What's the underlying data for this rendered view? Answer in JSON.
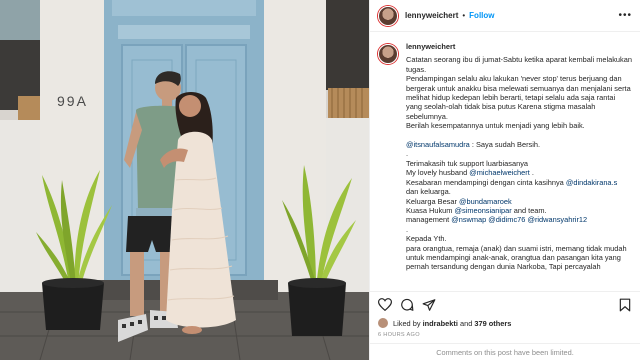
{
  "photo": {
    "house_number": "99A"
  },
  "header": {
    "username": "lennyweichert",
    "separator": "•",
    "follow_label": "Follow",
    "more_icon": "more-icon"
  },
  "caption": {
    "username": "lennyweichert",
    "lines": {
      "l1": "Catatan seorang ibu di jumat-Sabtu ketika aparat kembali melakukan tugas.",
      "l2": "Pendampingan selalu aku lakukan 'never stop' terus berjuang dan bergerak untuk anakku bisa melewati semuanya dan menjalani serta melihat hidup kedepan lebih berarti, tetapi selalu ada saja rantai yang seolah-olah tidak bisa putus Karena stigma masalah sebelumnya.",
      "l3": "Berilah kesempatannya untuk menjadi yang lebih baik.",
      "m1": "@itsnaufalsamudra",
      "l4": " : Saya sudah Bersih.",
      "dot1": ".",
      "l5": "Terimakasih tuk support luarbiasanya",
      "l6a": "My lovely husband ",
      "m2": "@michaelweichert",
      "l6b": " .",
      "l7a": "Kesabaran mendampingi dengan cinta kasihnya ",
      "m3": "@dindakirana.s",
      "l7b": "dan keluarga.",
      "l8a": "Keluarga Besar ",
      "m4": "@bundamaroek",
      "l9a": "Kuasa Hukum ",
      "m5": "@simeonsianipar",
      "l9b": " and team.",
      "l10a": "management ",
      "m6": "@nswmap",
      "m7": "@didimc76",
      "m8": "@ridwansyahrir12",
      "dot2": ".",
      "l11": "Kepada Yth.",
      "l12": "para orangtua, remaja (anak) dan suami istri, memang tidak mudah untuk mendampingi anak-anak, orangtua dan pasangan kita yang pernah tersandung dengan dunia Narkoba, Tapi percayalah"
    }
  },
  "actions": {
    "like_icon": "heart-icon",
    "comment_icon": "comment-icon",
    "share_icon": "share-icon",
    "save_icon": "bookmark-icon"
  },
  "likes": {
    "prefix": "Liked by ",
    "user": "indrabekti",
    "middle": " and ",
    "others": "379 others"
  },
  "time": "6 HOURS AGO",
  "comments_notice": "Comments on this post have been limited.",
  "colors": {
    "link": "#00376b",
    "follow": "#0095f6",
    "muted": "#8e8e8e"
  }
}
